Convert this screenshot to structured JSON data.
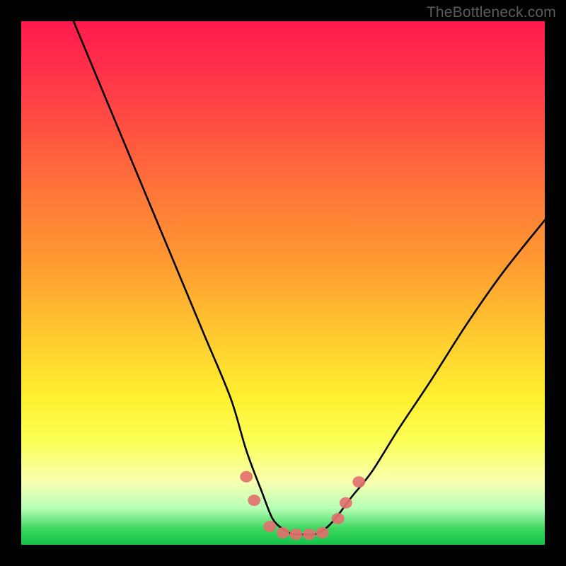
{
  "watermark": "TheBottleneck.com",
  "chart_data": {
    "type": "line",
    "title": "",
    "xlabel": "",
    "ylabel": "",
    "xlim": [
      0,
      100
    ],
    "ylim": [
      0,
      100
    ],
    "series": [
      {
        "name": "curve",
        "x": [
          10,
          15,
          20,
          25,
          30,
          35,
          40,
          43,
          46,
          48,
          50,
          52,
          54,
          56,
          58,
          60,
          63,
          67,
          72,
          78,
          85,
          92,
          100
        ],
        "values": [
          100,
          88,
          76,
          64,
          52,
          40,
          28,
          18,
          10,
          5,
          3,
          2,
          2,
          2,
          3,
          5,
          9,
          14,
          22,
          31,
          42,
          52,
          62
        ]
      }
    ],
    "markers": [
      {
        "x": 43.0,
        "y": 13.0
      },
      {
        "x": 44.5,
        "y": 8.5
      },
      {
        "x": 47.5,
        "y": 3.5
      },
      {
        "x": 50.0,
        "y": 2.3
      },
      {
        "x": 52.5,
        "y": 2.0
      },
      {
        "x": 55.0,
        "y": 2.0
      },
      {
        "x": 57.5,
        "y": 2.3
      },
      {
        "x": 60.5,
        "y": 5.0
      },
      {
        "x": 62.0,
        "y": 8.0
      },
      {
        "x": 64.5,
        "y": 12.0
      }
    ],
    "marker_color": "#e2716e",
    "curve_color": "#000000"
  }
}
